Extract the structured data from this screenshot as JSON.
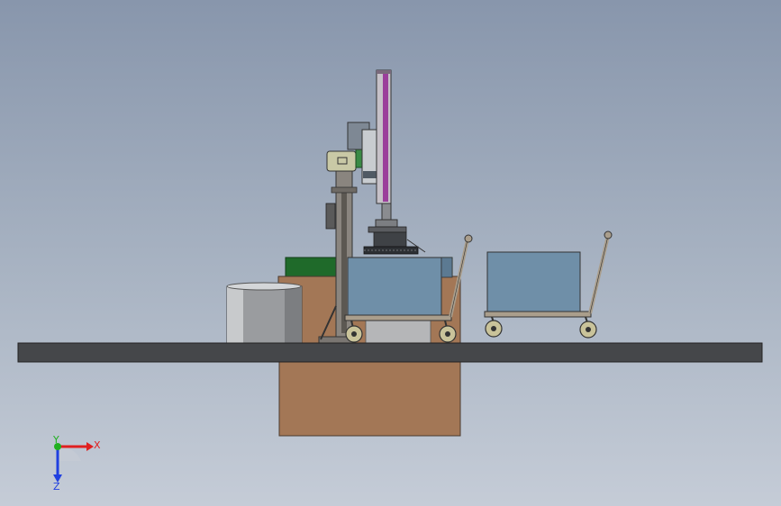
{
  "view": {
    "background_top": "#8896ac",
    "background_bottom": "#c5ccd7"
  },
  "triad": {
    "x_label": "X",
    "y_label": "Y",
    "z_label": "Z",
    "x_color": "#e02020",
    "y_color": "#20b020",
    "z_color": "#2040e0"
  },
  "colors": {
    "floor": "#45474a",
    "pit": "#a37756",
    "planter": "#1f6a2a",
    "column": "#7a7672",
    "carriage_arm": "#9b3f9b",
    "bin": "#6f8fa8",
    "trolley_frame": "#aa9e8c",
    "drum": "#9a9c9f",
    "equipment": "#c9c9a6"
  }
}
